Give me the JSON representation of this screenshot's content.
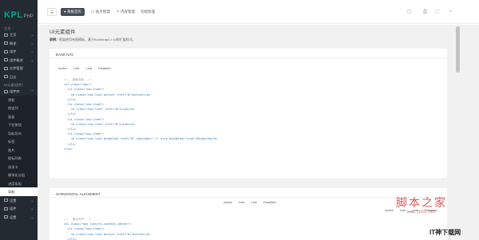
{
  "logo": {
    "main": "KPL",
    "sub": "PHP"
  },
  "sidebar": {
    "group_main": "主页",
    "items": [
      {
        "label": "主页"
      },
      {
        "label": "概述"
      },
      {
        "label": "组件"
      },
      {
        "label": "组件概述"
      },
      {
        "label": "文件管理"
      },
      {
        "label": "日志"
      }
    ],
    "group_ui": "UI元素(组件)",
    "group_ui_label": "组件库",
    "sub_items": [
      "阴影",
      "按钮列",
      "面板",
      "下拉按钮",
      "导航导向",
      "标签",
      "图片",
      "图标列表",
      "选项卡",
      "模块化分组",
      "进度条组",
      "导航"
    ],
    "bottom_items": [
      "设置",
      "组件",
      "设置"
    ]
  },
  "topbar": {
    "menu_icon": "☰",
    "home_label": "● 系统首页",
    "tab2_label": "▤ 站点管理",
    "tab3_label": "✎ 内容管理",
    "tab4_label": "功能管理",
    "icons": [
      "◻",
      "⎙",
      "⬚",
      "◔"
    ]
  },
  "page": {
    "title": "UI元素组件",
    "desc_label": "说明：",
    "desc_text": "框架使用有限模板，基于Bootstrap3.x UI的扩展样式。"
  },
  "card1": {
    "title": "BASE NAV",
    "nav_items": [
      "Active",
      "Link",
      "Link",
      "Disabled"
    ],
    "code": [
      {
        "t": "c",
        "s": "<!-- 基础导航 -->"
      },
      {
        "t": "t",
        "s": "<ul class=\"nav\">"
      },
      {
        "t": "t",
        "s": "  <li class=\"nav-item\">"
      },
      {
        "t": "t",
        "s": "    <a class=\"nav-link active\" href=\"#\">Active</a>"
      },
      {
        "t": "t",
        "s": "  </li>"
      },
      {
        "t": "t",
        "s": "  <li class=\"nav-item\">"
      },
      {
        "t": "t",
        "s": "    <a class=\"nav-link\" href=\"#\">Link</a>"
      },
      {
        "t": "t",
        "s": "  </li>"
      },
      {
        "t": "t",
        "s": "  <li class=\"nav-item\">"
      },
      {
        "t": "t",
        "s": "    <a class=\"nav-link\" href=\"#\">Link</a>"
      },
      {
        "t": "t",
        "s": "  </li>"
      },
      {
        "t": "t",
        "s": "  <li class=\"nav-item\">"
      },
      {
        "t": "t",
        "s": "    <a class=\"nav-link disabled\" href=\"#\" tabindex=\"-1\" aria-disabled=\"true\">Disabled</a>"
      },
      {
        "t": "t",
        "s": "  </li>"
      },
      {
        "t": "t",
        "s": "</ul>"
      }
    ]
  },
  "card2": {
    "title": "HORIZONTAL ALIGNMENT",
    "center_nav": [
      "Active",
      "Link",
      "Link",
      "Disabled"
    ],
    "right_nav": [
      "Active",
      "Link",
      "Link",
      "Disabled"
    ],
    "code": [
      {
        "t": "c",
        "s": "<!-- 居中对齐 -->"
      },
      {
        "t": "t",
        "s": "<ul class=\"nav justify-content-center\">"
      },
      {
        "t": "t",
        "s": "  <li class=\"nav-item\">"
      },
      {
        "t": "t",
        "s": "    <a class=\"nav-link active\" href=\"#\">Active</a>"
      },
      {
        "t": "t",
        "s": "  </li>"
      }
    ]
  },
  "watermark": {
    "main": "脚本之家",
    "sub": "www.jb51.net"
  },
  "corner_mark": "IT神下载网",
  "colors": {
    "sidebar": "#242a31",
    "accent": "#00a78e",
    "background": "#f1f1f1"
  }
}
